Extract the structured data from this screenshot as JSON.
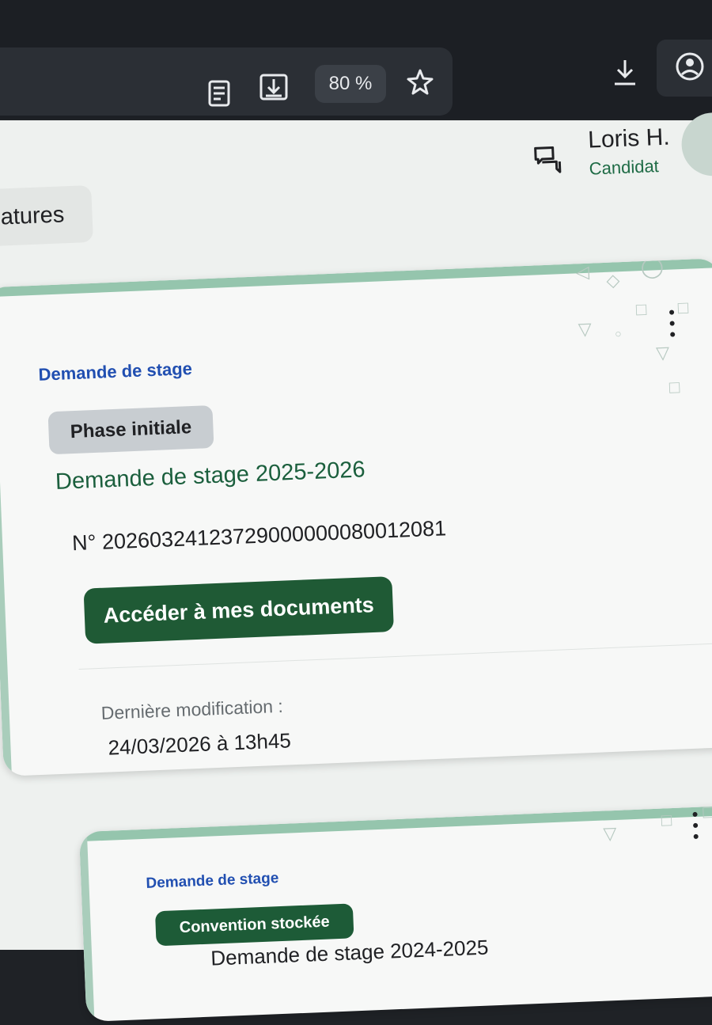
{
  "browser": {
    "zoom_label": "80 %",
    "icons": {
      "reader": "reader-icon",
      "download_page": "download-page-icon",
      "favorite": "star-icon",
      "downloads": "download-icon",
      "profile": "profile-icon"
    }
  },
  "header": {
    "tab_label": "datures",
    "user_name": "Loris H.",
    "user_role": "Candidat",
    "chat_icon": "chat-icon"
  },
  "cards": [
    {
      "eyebrow": "Demande de stage",
      "status": "Phase initiale",
      "title": "Demande de stage 2025-2026",
      "number": "N° 20260324123729000000080012081",
      "button_label": "Accéder à mes documents",
      "last_modified_label": "Dernière modification :",
      "last_modified_value": "24/03/2026 à 13h45"
    },
    {
      "eyebrow": "Demande de stage",
      "status": "Convention stockée",
      "title": "Demande de stage 2024-2025"
    }
  ],
  "colors": {
    "accent_green": "#1f5a35",
    "eyebrow_blue": "#214fb1",
    "status_gray": "#c8cdd1",
    "card_bg": "#f7f8f7",
    "browser_bg": "#1c1f24"
  }
}
